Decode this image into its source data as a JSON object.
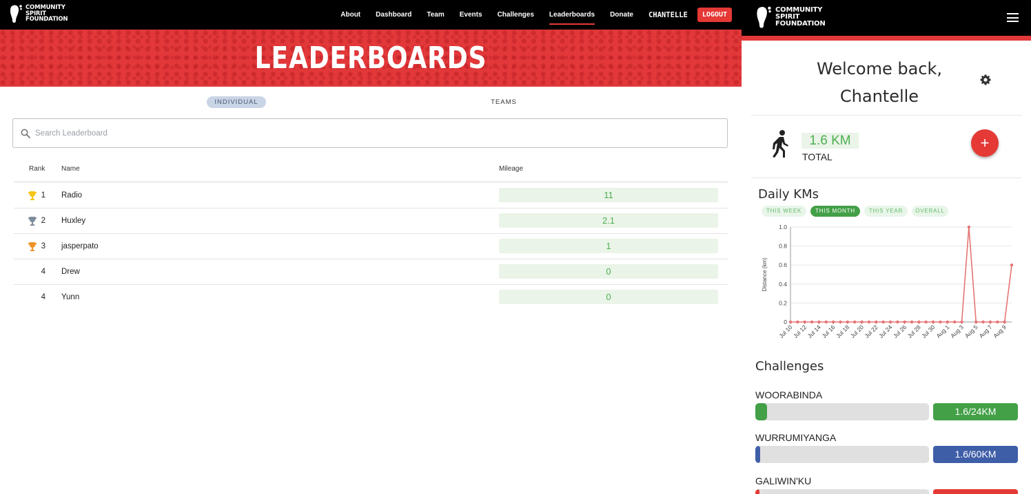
{
  "desktop": {
    "logo": {
      "line1": "COMMUNITY",
      "line2": "SPIRIT",
      "line3": "FOUNDATION"
    },
    "nav": {
      "about": "About",
      "dashboard": "Dashboard",
      "team": "Team",
      "events": "Events",
      "challenges": "Challenges",
      "leaderboards": "Leaderboards",
      "donate": "Donate",
      "user": "CHANTELLE",
      "logout": "LOGOUT"
    },
    "hero_title": "LEADERBOARDS",
    "tabs": {
      "individual": "INDIVIDUAL",
      "teams": "TEAMS"
    },
    "search": {
      "placeholder": "Search Leaderboard"
    },
    "table": {
      "headers": {
        "rank": "Rank",
        "name": "Name",
        "mileage": "Mileage"
      },
      "rows": [
        {
          "rank": "1",
          "name": "Radio",
          "mileage": "11",
          "trophy": "gold"
        },
        {
          "rank": "2",
          "name": "Huxley",
          "mileage": "2.1",
          "trophy": "silver"
        },
        {
          "rank": "3",
          "name": "jasperpato",
          "mileage": "1",
          "trophy": "bronze"
        },
        {
          "rank": "4",
          "name": "Drew",
          "mileage": "0",
          "trophy": "none"
        },
        {
          "rank": "4",
          "name": "Yunn",
          "mileage": "0",
          "trophy": "none"
        }
      ]
    }
  },
  "mobile": {
    "logo": {
      "line1": "COMMUNITY",
      "line2": "SPIRIT",
      "line3": "FOUNDATION"
    },
    "welcome_line1": "Welcome back,",
    "welcome_line2": "Chantelle",
    "total_km": "1.6 KM",
    "total_label": "TOTAL",
    "daily_title": "Daily KMs",
    "filters": {
      "week": "THIS WEEK",
      "month": "THIS MONTH",
      "year": "THIS YEAR",
      "overall": "OVERALL"
    },
    "challenges_title": "Challenges",
    "challenges": [
      {
        "name": "WOORABINDA",
        "label": "1.6/24KM",
        "progress": 0.067,
        "color": "#43a047"
      },
      {
        "name": "WURRUMIYANGA",
        "label": "1.6/60KM",
        "progress": 0.027,
        "color": "#3f5ea8"
      },
      {
        "name": "GALIWIN'KU",
        "label": "",
        "progress": 0.02,
        "color": "#e53935"
      }
    ]
  },
  "colors": {
    "brand_red": "#e53935",
    "green": "#43a047",
    "blue": "#3f5ea8",
    "line": "#e57373"
  },
  "chart_data": {
    "type": "line",
    "ylabel": "Distance (km)",
    "xlabel": "",
    "ylim": [
      0,
      1.0
    ],
    "yticks": [
      "0",
      "0.2",
      "0.4",
      "0.6",
      "0.8",
      "1.0"
    ],
    "x": [
      "Jul 10",
      "Jul 11",
      "Jul 12",
      "Jul 13",
      "Jul 14",
      "Jul 15",
      "Jul 16",
      "Jul 17",
      "Jul 18",
      "Jul 19",
      "Jul 20",
      "Jul 21",
      "Jul 22",
      "Jul 23",
      "Jul 24",
      "Jul 25",
      "Jul 26",
      "Jul 27",
      "Jul 28",
      "Jul 29",
      "Jul 30",
      "Jul 31",
      "Aug 1",
      "Aug 2",
      "Aug 3",
      "Aug 4",
      "Aug 5",
      "Aug 6",
      "Aug 7",
      "Aug 8",
      "Aug 9",
      "Aug 10"
    ],
    "values": [
      0,
      0,
      0,
      0,
      0,
      0,
      0,
      0,
      0,
      0,
      0,
      0,
      0,
      0,
      0,
      0,
      0,
      0,
      0,
      0,
      0,
      0,
      0,
      0,
      0,
      1.0,
      0,
      0,
      0,
      0,
      0,
      0.6
    ],
    "tick_labels": [
      "Jul 10",
      "Jul 12",
      "Jul 14",
      "Jul 16",
      "Jul 18",
      "Jul 20",
      "Jul 22",
      "Jul 24",
      "Jul 26",
      "Jul 28",
      "Jul 30",
      "Aug 1",
      "Aug 3",
      "Aug 5",
      "Aug 7",
      "Aug 9"
    ],
    "grid": true
  }
}
